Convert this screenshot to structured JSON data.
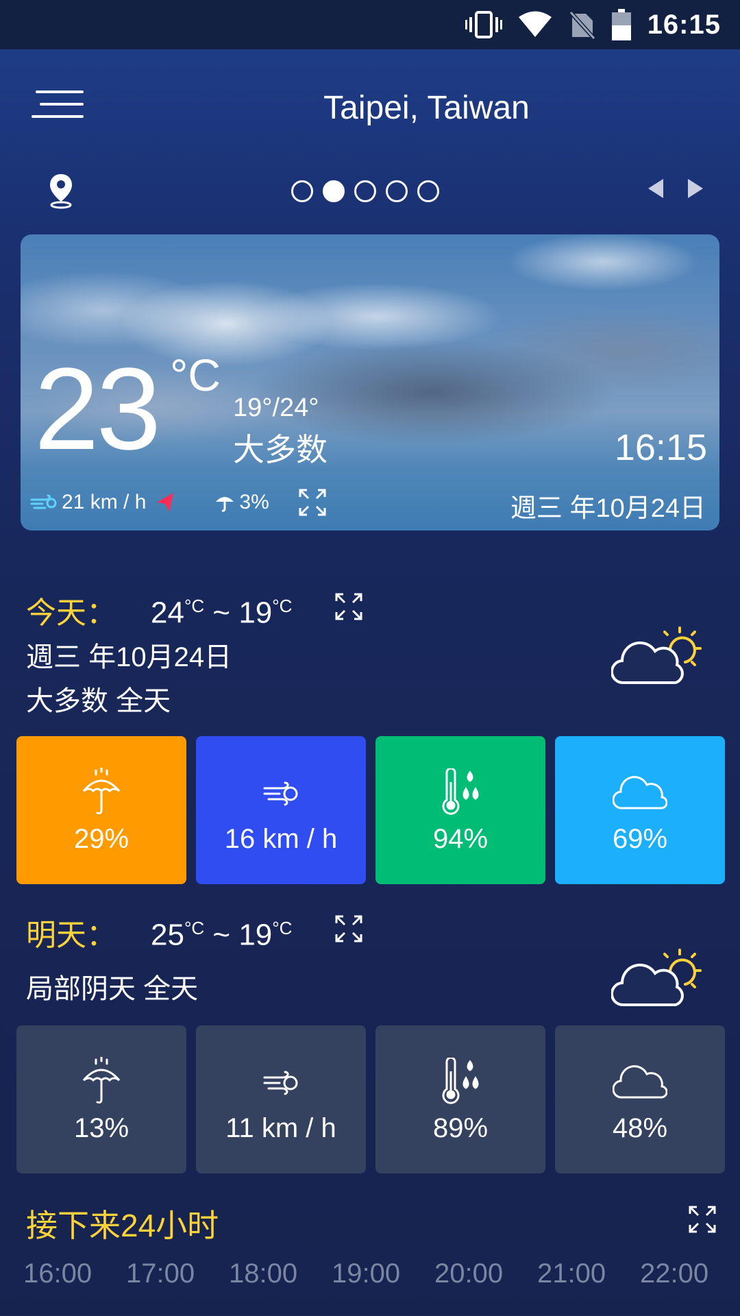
{
  "status_bar": {
    "time": "16:15",
    "icons": [
      "vibrate-icon",
      "wifi-icon",
      "no-sim-icon",
      "battery-icon"
    ]
  },
  "header": {
    "city": "Taipei, Taiwan",
    "page_count": 5,
    "active_page": 2
  },
  "current": {
    "temperature": "23",
    "unit": "°C",
    "range": "19°/24°",
    "condition": "大多数",
    "time": "16:15",
    "date": "週三 年10月24日",
    "wind": "21 km / h",
    "precip": "3%"
  },
  "today": {
    "label": "今天：",
    "high": "24",
    "low": "19",
    "unit": "°C",
    "sep": "~",
    "date": "週三 年10月24日",
    "summary": "大多数 全天",
    "tiles": [
      {
        "icon": "umbrella-icon",
        "value": "29%",
        "color": "#ff9a00"
      },
      {
        "icon": "wind-icon",
        "value": "16 km / h",
        "color": "#2f4df0"
      },
      {
        "icon": "humidity-icon",
        "value": "94%",
        "color": "#00bc75"
      },
      {
        "icon": "cloud-icon",
        "value": "69%",
        "color": "#1baffc"
      }
    ]
  },
  "tomorrow": {
    "label": "明天：",
    "high": "25",
    "low": "19",
    "unit": "°C",
    "sep": "~",
    "summary": "局部阴天 全天",
    "tiles": [
      {
        "icon": "umbrella-icon",
        "value": "13%"
      },
      {
        "icon": "wind-icon",
        "value": "11 km / h"
      },
      {
        "icon": "humidity-icon",
        "value": "89%"
      },
      {
        "icon": "cloud-icon",
        "value": "48%"
      }
    ]
  },
  "next24": {
    "title": "接下来24小时",
    "hours": [
      "16:00",
      "17:00",
      "18:00",
      "19:00",
      "20:00",
      "21:00",
      "22:00"
    ]
  },
  "colors": {
    "accent_yellow": "#ffd23a",
    "wind_arrow": "#ff2d55"
  }
}
